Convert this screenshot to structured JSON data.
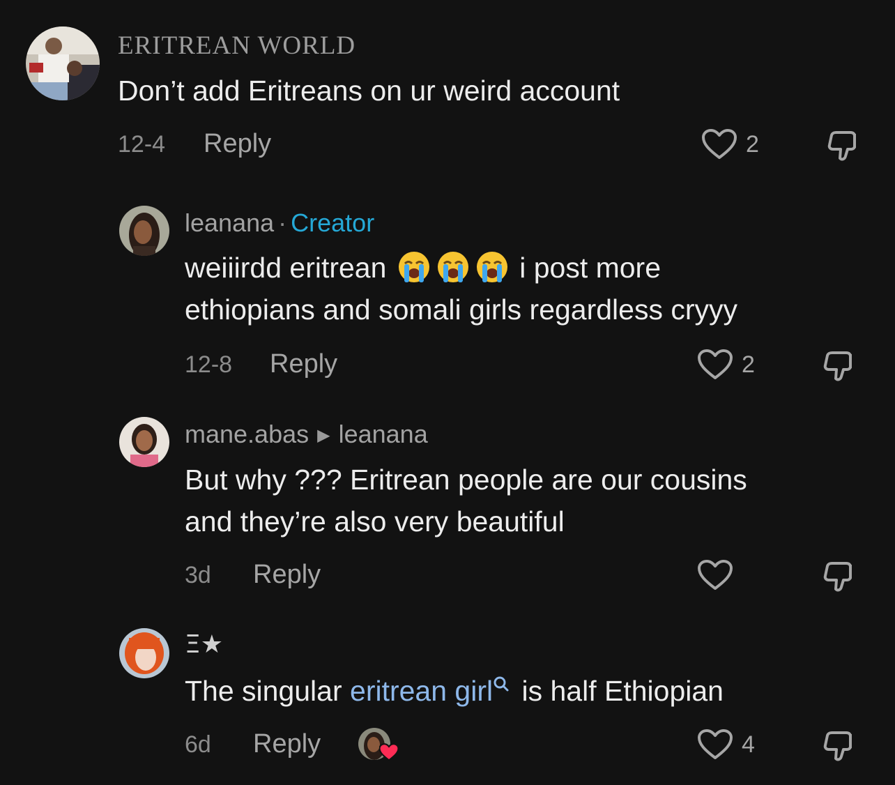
{
  "comments": [
    {
      "author": "ERITREAN WORLD",
      "text": "Don’t add Eritreans on ur weird account",
      "date": "12-4",
      "reply_label": "Reply",
      "likes": "2"
    },
    {
      "author": "leanana",
      "separator": "·",
      "badge": "Creator",
      "text_line1_a": "weiiirdd eritrean",
      "text_line1_b": "i post more",
      "text_line2": "ethiopians and somali girls regardless cryyy",
      "emoji": "loudly-crying-face",
      "date": "12-8",
      "reply_label": "Reply",
      "likes": "2"
    },
    {
      "author": "mane.abas",
      "reply_to": "leanana",
      "text_line1": "But why ??? Eritrean people are our cousins",
      "text_line2": "and they’re also very beautiful",
      "date": "3d",
      "reply_label": "Reply"
    },
    {
      "author": "Ξ★",
      "text_before": "The singular ",
      "keyword": "eritrean girl",
      "text_after": " is half Ethiopian",
      "date": "6d",
      "reply_label": "Reply",
      "likes": "4",
      "creator_liked": true
    }
  ],
  "colors": {
    "background": "#121212",
    "creator_badge": "#25a8d6",
    "keyword_link": "#8eb8ea",
    "heart": "#fe2c55"
  }
}
